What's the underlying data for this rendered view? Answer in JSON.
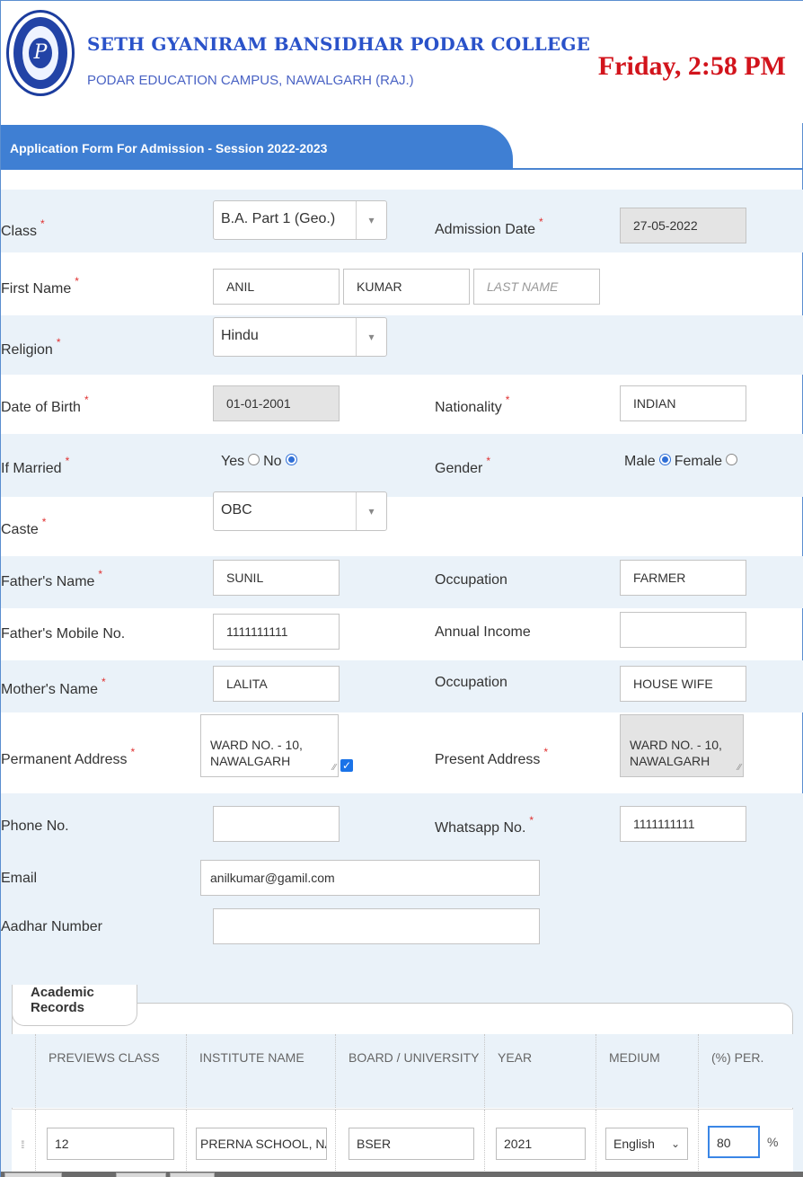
{
  "header": {
    "college_name": "SETH GYANIRAM BANSIDHAR PODAR COLLEGE",
    "college_sub": "PODAR EDUCATION CAMPUS, NAWALGARH (RAJ.)",
    "clock": "Friday, 2:58 PM",
    "tab_title": "Application Form For Admission - Session 2022-2023"
  },
  "required_mark": "*",
  "form": {
    "class_label": "Class",
    "class_value": "B.A. Part 1 (Geo.)",
    "admission_date_label": "Admission Date",
    "admission_date_value": "27-05-2022",
    "first_name_label": "First Name",
    "first_name_value": "ANIL",
    "middle_name_value": "KUMAR",
    "last_name_placeholder": "LAST NAME",
    "religion_label": "Religion",
    "religion_value": "Hindu",
    "dob_label": "Date of Birth",
    "dob_value": "01-01-2001",
    "nationality_label": "Nationality",
    "nationality_value": "INDIAN",
    "married_label": "If Married",
    "married_yes": "Yes",
    "married_no": "No",
    "gender_label": "Gender",
    "gender_male": "Male",
    "gender_female": "Female",
    "caste_label": "Caste",
    "caste_value": "OBC",
    "father_name_label": "Father's Name",
    "father_name_value": "SUNIL",
    "father_occupation_label": "Occupation",
    "father_occupation_value": "FARMER",
    "father_mobile_label": "Father's Mobile No.",
    "father_mobile_value": "1111111111",
    "annual_income_label": "Annual Income",
    "annual_income_value": "",
    "mother_name_label": "Mother's Name",
    "mother_name_value": "LALITA",
    "mother_occupation_label": "Occupation",
    "mother_occupation_value": "HOUSE WIFE",
    "permanent_address_label": "Permanent Address",
    "permanent_address_value": "WARD NO. - 10,\nNAWALGARH",
    "present_address_label": "Present Address",
    "present_address_value": "WARD NO. - 10,\nNAWALGARH",
    "phone_label": "Phone No.",
    "phone_value": "",
    "whatsapp_label": "Whatsapp No.",
    "whatsapp_value": "1111111111",
    "email_label": "Email",
    "email_value": "anilkumar@gamil.com",
    "aadhar_label": "Aadhar Number",
    "aadhar_value": ""
  },
  "academic": {
    "legend": "Academic Records",
    "columns": [
      "PREVIEWS CLASS",
      "INSTITUTE NAME",
      "BOARD / UNIVERSITY",
      "YEAR",
      "MEDIUM",
      "(%) PER."
    ],
    "row": {
      "class": "12",
      "institute": "PRERNA SCHOOL, NAWA",
      "board": "BSER",
      "year": "2021",
      "medium": "English",
      "percent": "80",
      "percent_suffix": "%"
    }
  },
  "icons": {
    "select_arrow": "▾",
    "grip": "⁞⁞",
    "resize": "∕∕",
    "check": "✓",
    "medium_chevron": "⌄"
  }
}
